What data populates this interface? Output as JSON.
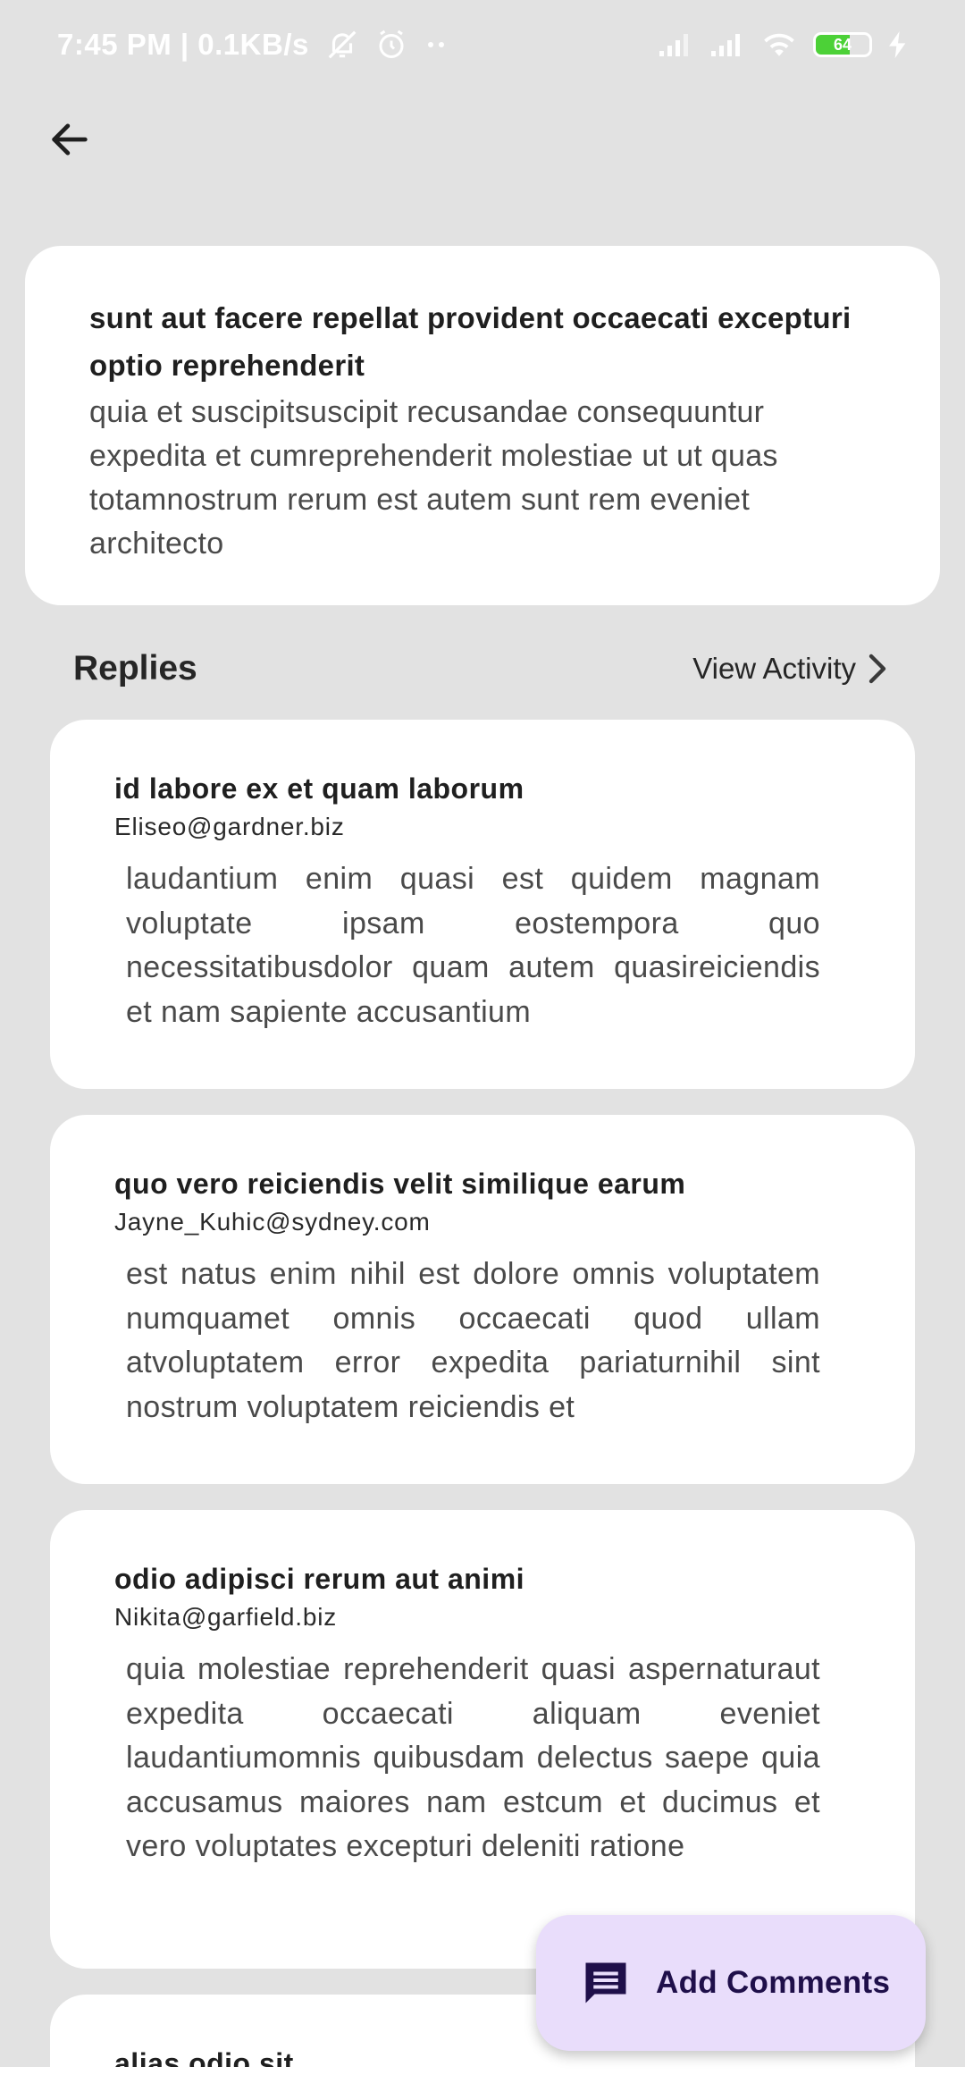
{
  "status_bar": {
    "time_speed": "7:45 PM | 0.1KB/s",
    "battery": "64",
    "battery_level": 0.64,
    "icons": [
      "mute-icon",
      "alarm-icon",
      "more-dots-icon",
      "signal-icon",
      "signal-icon",
      "wifi-icon",
      "battery-icon",
      "charging-icon"
    ]
  },
  "header": {
    "back_icon": "arrow-left-icon"
  },
  "post": {
    "title": "sunt aut facere repellat provident occaecati excepturi optio reprehenderit",
    "body": "quia et suscipitsuscipit recusandae consequuntur expedita et cumreprehenderit molestiae ut ut quas totamnostrum rerum est autem sunt rem eveniet architecto"
  },
  "replies": {
    "title": "Replies",
    "view_activity": "View Activity",
    "comments": [
      {
        "name": "id labore ex et quam laborum",
        "email": "Eliseo@gardner.biz",
        "body": "laudantium enim quasi est quidem magnam voluptate ipsam eostempora quo necessitatibusdolor quam autem quasireiciendis et nam sapiente accusantium"
      },
      {
        "name": "quo vero reiciendis velit similique earum",
        "email": "Jayne_Kuhic@sydney.com",
        "body": "est natus enim nihil est dolore omnis voluptatem numquamet omnis occaecati quod ullam atvoluptatem error expedita pariaturnihil sint nostrum voluptatem reiciendis et"
      },
      {
        "name": "odio adipisci rerum aut animi",
        "email": "Nikita@garfield.biz",
        "body": "quia molestiae reprehenderit quasi aspernaturaut expedita occaecati aliquam eveniet laudantiumomnis quibusdam delectus saepe quia accusamus maiores nam estcum et ducimus et vero voluptates excepturi deleniti ratione"
      },
      {
        "name": "alias odio sit",
        "email": "",
        "body": ""
      }
    ]
  },
  "fab": {
    "label": "Add Comments",
    "icon": "comment-icon"
  },
  "colors": {
    "background": "#e2e2e2",
    "card": "#ffffff",
    "fab_background": "#e9ddfb",
    "fab_text": "#1f0f4a"
  }
}
